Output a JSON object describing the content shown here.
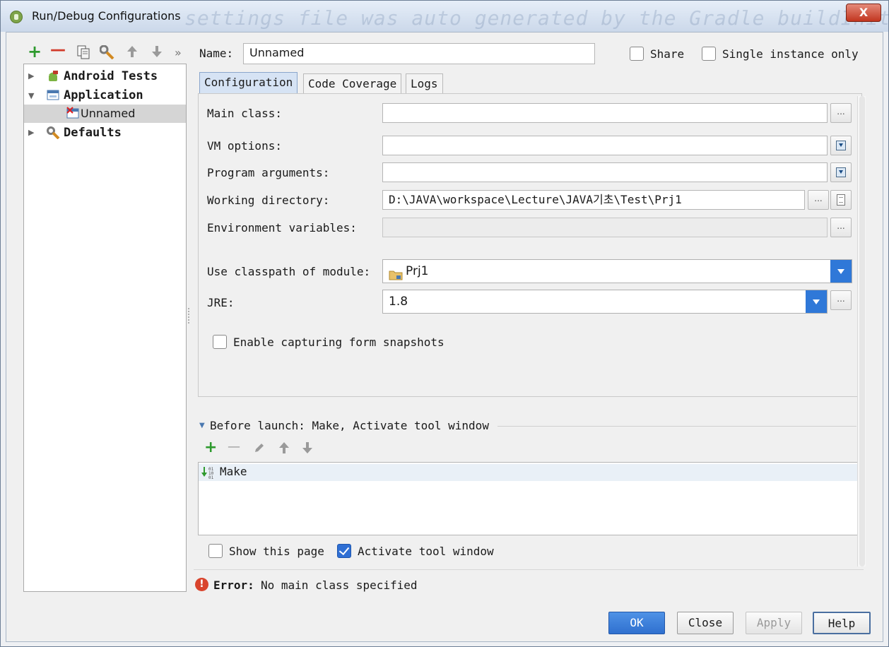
{
  "window": {
    "title": "Run/Debug Configurations",
    "background_text": "settings file was auto generated by the Gradle buildInit",
    "close_glyph": "X"
  },
  "toolbar": {
    "add_icon": "+",
    "remove_icon": "—",
    "more_icon": "»"
  },
  "tree": {
    "items": [
      {
        "label": "Android Tests",
        "icon": "android-icon",
        "expanded": false
      },
      {
        "label": "Application",
        "icon": "application-icon",
        "expanded": true
      },
      {
        "label": "Unnamed",
        "icon": "config-error-icon",
        "selected": true
      },
      {
        "label": "Defaults",
        "icon": "wrench-icon",
        "expanded": false
      }
    ]
  },
  "name_row": {
    "label": "Name:",
    "value": "Unnamed",
    "share_label": "Share",
    "share_checked": false,
    "single_instance_label": "Single instance only",
    "single_instance_checked": false
  },
  "tabs": [
    {
      "label": "Configuration",
      "active": true
    },
    {
      "label": "Code Coverage",
      "active": false
    },
    {
      "label": "Logs",
      "active": false
    }
  ],
  "config": {
    "main_class_label": "Main class:",
    "main_class_value": "",
    "vm_options_label": "VM options:",
    "vm_options_value": "",
    "program_args_label": "Program arguments:",
    "program_args_value": "",
    "working_dir_label": "Working directory:",
    "working_dir_value": "D:\\JAVA\\workspace\\Lecture\\JAVA기초\\Test\\Prj1",
    "env_vars_label": "Environment variables:",
    "env_vars_value": "",
    "classpath_label": "Use classpath of module:",
    "classpath_value": "Prj1",
    "jre_label": "JRE:",
    "jre_value": "1.8",
    "snapshot_label": "Enable capturing form snapshots",
    "snapshot_checked": false,
    "ellipsis": "..."
  },
  "before_launch": {
    "header": "Before launch: Make, Activate tool window",
    "items": [
      "Make"
    ],
    "add_icon": "+",
    "remove_icon": "—",
    "show_page_label": "Show this page",
    "show_page_checked": false,
    "activate_label": "Activate tool window",
    "activate_checked": true
  },
  "error": {
    "label": "Error:",
    "message": "No main class specified"
  },
  "buttons": {
    "ok": "OK",
    "close": "Close",
    "apply": "Apply",
    "help": "Help"
  },
  "colors": {
    "accent": "#2f70cf",
    "error": "#d9442c",
    "add_green": "#2e9a2e",
    "remove_red": "#d23a2a"
  }
}
